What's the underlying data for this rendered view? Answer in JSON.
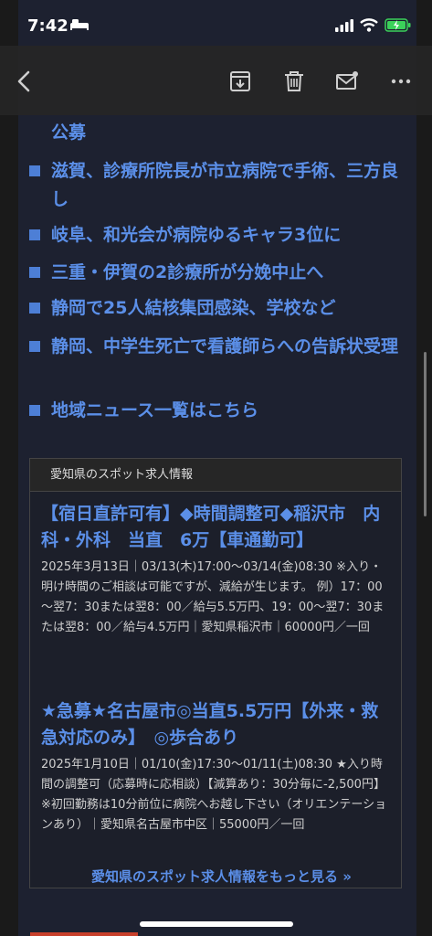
{
  "status": {
    "time": "7:42"
  },
  "toolbar": {
    "icons": [
      "back-icon",
      "archive-icon",
      "trash-icon",
      "mail-icon",
      "more-icon"
    ]
  },
  "news": [
    "公募",
    "滋賀、診療所院長が市立病院で手術、三方良し",
    "岐阜、和光会が病院ゆるキャラ3位に",
    "三重・伊賀の2診療所が分娩中止へ",
    "静岡で25人結核集団感染、学校など",
    "静岡、中学生死亡で看護師らへの告訴状受理",
    "地域ニュース一覧はこちら"
  ],
  "jobs": {
    "heading": "愛知県のスポット求人情報",
    "items": [
      {
        "title": "【宿日直許可有】◆時間調整可◆稲沢市　内科・外科　当直　6万【車通勤可】",
        "detail": "2025年3月13日｜03/13(木)17:00～03/14(金)08:30 ※入り・明け時間のご相談は可能ですが、減給が生じます。 例）17：00～翌7：30または翌8：00／給与5.5万円、19：00～翌7：30または翌8：00／給与4.5万円｜愛知県稲沢市｜60000円／一回"
      },
      {
        "title": "★急募★名古屋市◎当直5.5万円【外来・救急対応のみ】　◎歩合あり",
        "detail": "2025年1月10日｜01/10(金)17:30～01/11(土)08:30 ★入り時間の調整可（応募時に応相談）【減算あり：30分毎に-2,500円】 ※初回勤務は10分前位に病院へお越し下さい（オリエンテーションあり）｜愛知県名古屋市中区｜55000円／一回"
      }
    ],
    "more_link": "愛知県のスポット求人情報をもっと見る »"
  }
}
